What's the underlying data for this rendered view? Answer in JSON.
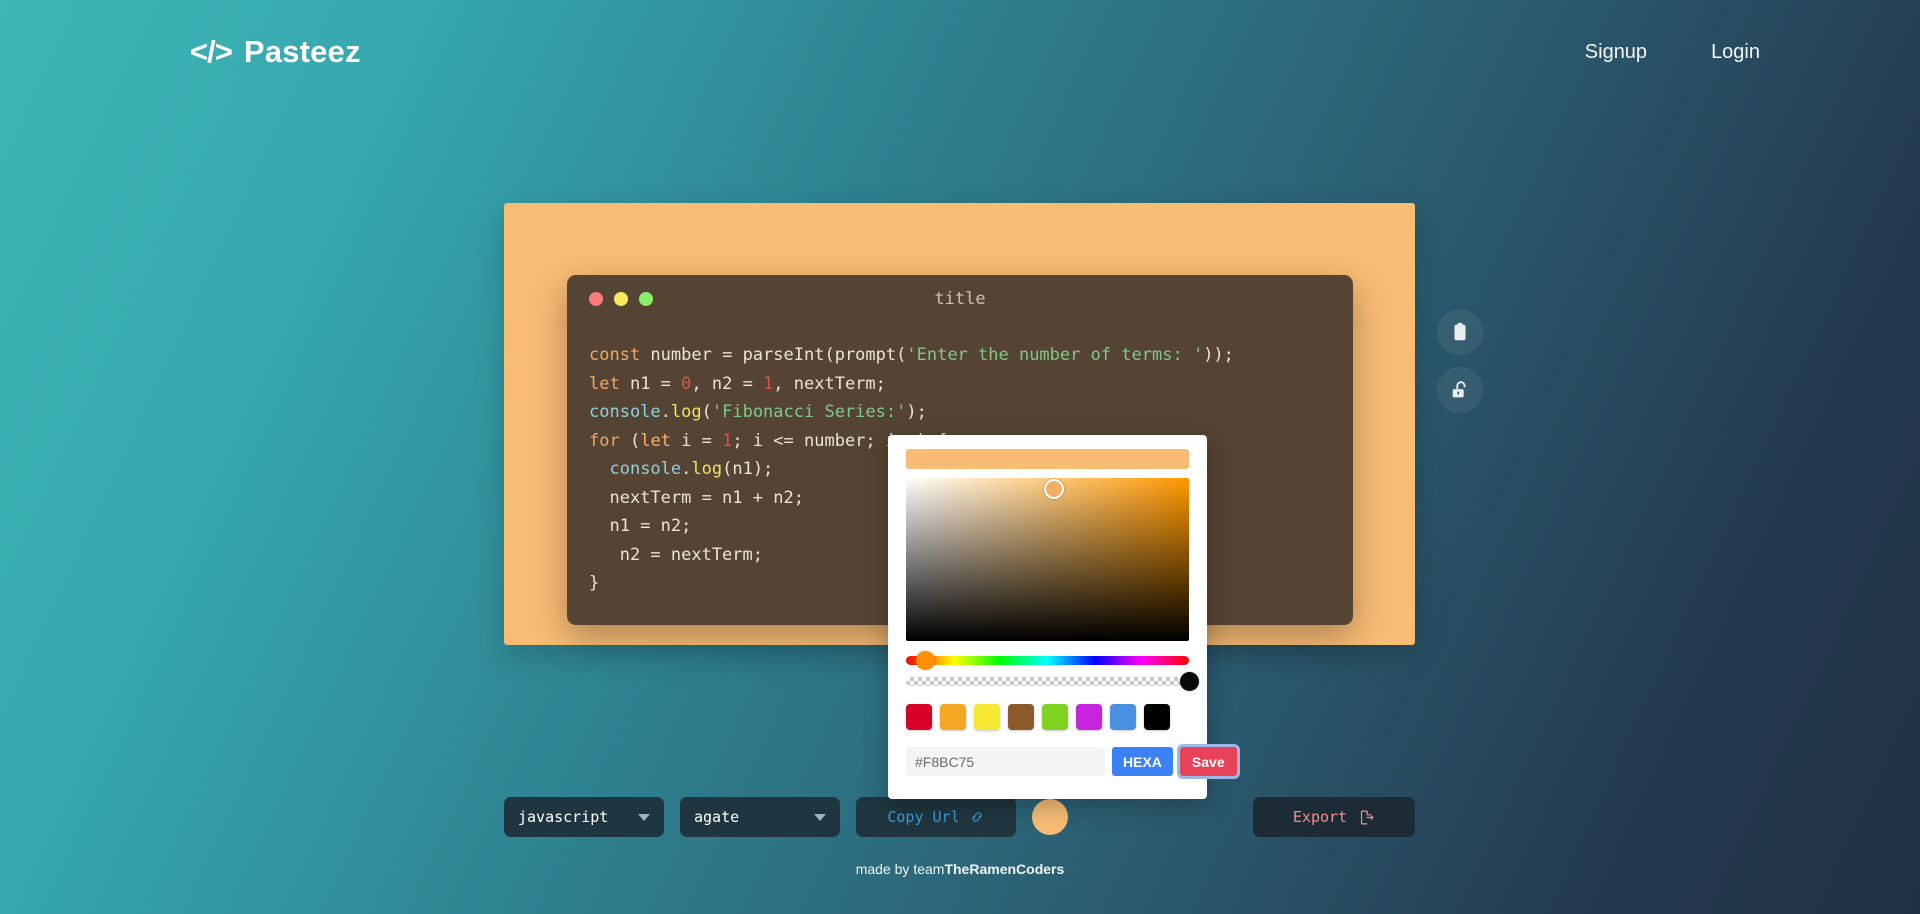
{
  "header": {
    "brand_glyph": "</>",
    "brand_name": "Pasteez",
    "nav": [
      {
        "label": "Signup",
        "name": "nav-signup"
      },
      {
        "label": "Login",
        "name": "nav-login"
      }
    ]
  },
  "editor": {
    "canvas_background": "#F8BC75",
    "window_background": "#554433",
    "window_title": "title",
    "traffic_lights": [
      "#F87C7C",
      "#F5E960",
      "#8CED6A"
    ],
    "code_lines": [
      [
        {
          "t": "const",
          "c": "tok-kw"
        },
        {
          "t": " number ",
          "c": "tok-plain"
        },
        {
          "t": "= ",
          "c": "tok-plain"
        },
        {
          "t": "parseInt",
          "c": "tok-plain"
        },
        {
          "t": "(",
          "c": "tok-plain"
        },
        {
          "t": "prompt",
          "c": "tok-plain"
        },
        {
          "t": "(",
          "c": "tok-plain"
        },
        {
          "t": "'Enter the number of terms: '",
          "c": "tok-str"
        },
        {
          "t": "));",
          "c": "tok-plain"
        }
      ],
      [
        {
          "t": "let",
          "c": "tok-kw"
        },
        {
          "t": " n1 = ",
          "c": "tok-plain"
        },
        {
          "t": "0",
          "c": "tok-num"
        },
        {
          "t": ", n2 = ",
          "c": "tok-plain"
        },
        {
          "t": "1",
          "c": "tok-num"
        },
        {
          "t": ", nextTerm;",
          "c": "tok-plain"
        }
      ],
      [
        {
          "t": "console",
          "c": "tok-fn"
        },
        {
          "t": ".",
          "c": "tok-plain"
        },
        {
          "t": "log",
          "c": "tok-prop"
        },
        {
          "t": "(",
          "c": "tok-plain"
        },
        {
          "t": "'Fibonacci Series:'",
          "c": "tok-str"
        },
        {
          "t": ");",
          "c": "tok-plain"
        }
      ],
      [
        {
          "t": "for",
          "c": "tok-kw"
        },
        {
          "t": " (",
          "c": "tok-plain"
        },
        {
          "t": "let",
          "c": "tok-kw2"
        },
        {
          "t": " i = ",
          "c": "tok-plain"
        },
        {
          "t": "1",
          "c": "tok-num"
        },
        {
          "t": "; i <= number; i++) {",
          "c": "tok-plain"
        }
      ],
      [
        {
          "t": "  ",
          "c": "tok-plain"
        },
        {
          "t": "console",
          "c": "tok-fn"
        },
        {
          "t": ".",
          "c": "tok-plain"
        },
        {
          "t": "log",
          "c": "tok-prop"
        },
        {
          "t": "(n1);",
          "c": "tok-plain"
        }
      ],
      [
        {
          "t": "  nextTerm = n1 + n2;",
          "c": "tok-plain"
        }
      ],
      [
        {
          "t": "  n1 = n2;",
          "c": "tok-plain"
        }
      ],
      [
        {
          "t": "   n2 = nextTerm;",
          "c": "tok-plain"
        }
      ],
      [
        {
          "t": "}",
          "c": "tok-plain"
        }
      ]
    ]
  },
  "side_tools": [
    {
      "name": "copy-to-clipboard-button",
      "icon": "clipboard-icon"
    },
    {
      "name": "unlock-button",
      "icon": "unlock-icon"
    }
  ],
  "controls": {
    "language_select": {
      "value": "javascript",
      "name": "language-select"
    },
    "theme_select": {
      "value": "agate",
      "name": "theme-select"
    },
    "copy_url_label": "Copy Url",
    "background_color": "#F8BC75",
    "export_label": "Export"
  },
  "color_picker": {
    "preview_color": "#F8BC75",
    "hex_value": "#F8BC75",
    "format_label": "HEXA",
    "save_label": "Save",
    "swatches": [
      "#D80027",
      "#F5A623",
      "#F7E831",
      "#8B5A2B",
      "#7ED321",
      "#C724E0",
      "#4A90E2",
      "#000000"
    ],
    "hue_thumb_color": "#FF9000",
    "alpha_thumb_color": "#0A0A0A"
  },
  "footer": {
    "prefix": "made by team ",
    "team": "TheRamenCoders"
  }
}
